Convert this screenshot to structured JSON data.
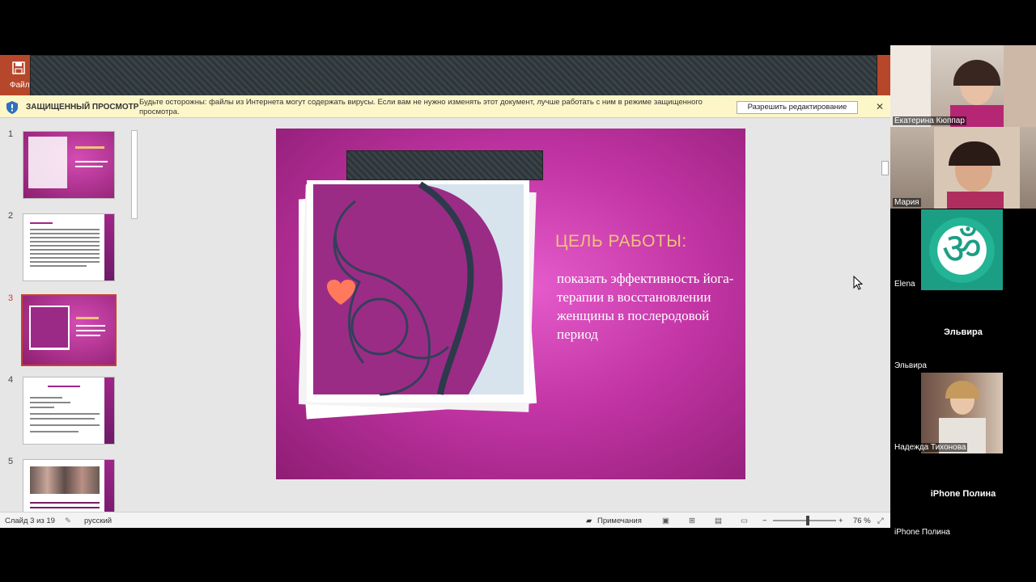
{
  "ppt": {
    "file_tab": "Файл",
    "protected_view": {
      "title": "ЗАЩИЩЕННЫЙ ПРОСМОТР",
      "message": "Будьте осторожны: файлы из Интернета могут содержать вирусы. Если вам не нужно изменять этот документ, лучше работать с ним в режиме защищенного просмотра.",
      "enable_button": "Разрешить редактирование",
      "close": "✕"
    },
    "thumbnails": [
      {
        "num": "1",
        "style": "magenta"
      },
      {
        "num": "2",
        "style": "white"
      },
      {
        "num": "3",
        "style": "magenta",
        "selected": true
      },
      {
        "num": "4",
        "style": "white"
      },
      {
        "num": "5",
        "style": "white"
      }
    ],
    "slide": {
      "heading": "ЦЕЛЬ РАБОТЫ:",
      "body": "показать эффективность йога-терапии в восстановлении женщины в послеродовой период"
    },
    "status": {
      "slide_counter": "Слайд 3 из 19",
      "language": "русский",
      "notes": "Примечания",
      "zoom": "76 %",
      "zoom_level": 0.55
    }
  },
  "participants": [
    {
      "name": "Екатерина Кюппар",
      "type": "video"
    },
    {
      "name": "Мария",
      "type": "video"
    },
    {
      "name": "Elena",
      "type": "avatar"
    },
    {
      "name": "Эльвира",
      "center_label": "Эльвира",
      "type": "name"
    },
    {
      "name": "Надежда Тихонова",
      "type": "avatar"
    },
    {
      "name": "iPhone Полина",
      "center_label": "iPhone Полина",
      "type": "name"
    }
  ],
  "colors": {
    "ribbon": "#b7472a",
    "slide_magenta": "#c335a5",
    "heading_gold": "#f0c27a",
    "selection_border": "#c8402a"
  }
}
